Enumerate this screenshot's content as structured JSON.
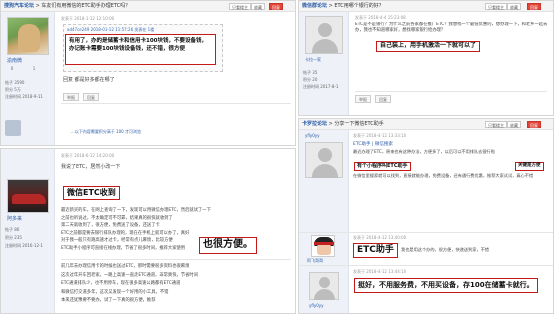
{
  "panel_a": {
    "site": "搜狗汽车论坛",
    "title": "车友们有用微信的ETC助手办理ETC吗？",
    "btn_a": "只看楼主",
    "btn_b": "收藏",
    "btn_c": "回复",
    "username": "渝南微",
    "user_stats": [
      "0",
      "1",
      "0"
    ],
    "user_info": [
      "帖子 3590",
      "积分 5万",
      "注册时间 2018-9-11"
    ],
    "meta": "发表于 2018-1-12 12:10:00",
    "quote_head": "ad47ce249 2018-01-12 11:57:26 发表在 1楼",
    "quote_text": "有用了，办的是储蓄卡和信用卡都可以办，不需要设备，办完了很快就能收到，还不错，我的车都是在上面办的",
    "highlight": "有用了，办的是储蓄卡和信用卡100块钱，不要设备钱，办记账卡需要100块钱设备钱，还不错，很方便",
    "reply": "回复 都是好多都在哪了",
    "btn_report": "举报",
    "btn_reply": "回复",
    "footer_link": "...以下内容需要积分高于 100 才可浏览"
  },
  "panel_b": {
    "site": "微信群论坛",
    "title": "ETC用哪个银行的好？",
    "btn_a": "只看楼主",
    "btn_b": "收藏",
    "btn_c": "回复",
    "username": "卡拉一家",
    "user_info": [
      "帖子 35",
      "积分 20",
      "注册时间 2017-8-1"
    ],
    "meta": "发表于 2018-4-4 15:23:08",
    "text": "ETC是不是银行？为什么之前各家都在推广ETC？我想找一个最低优惠的，想办理一下，和老乡一起去办，我也不知道哪家好，想找哪家银行给办理？",
    "highlight": "自己装上，用手机激活一下就可以了",
    "btn_report": "举报",
    "btn_reply": "回复"
  },
  "panel_c": {
    "username": "阿多来",
    "user_info": [
      "帖子 86",
      "积分 235",
      "注册时间 2016-12-1"
    ],
    "meta": "发表于 2018-6-12 14:20:00",
    "title": "我说了ETC，居然小改一下",
    "highlight1": "微信ETC收到",
    "lines": [
      "最近新买的车，在网上查询了一下，发现可以用微信办理ETC，然后就试了一下",
      "之前也听说过，不太确定可不可靠，结果真的很快就收到了",
      "第二天就收到了，很方便，免费送了设备，还送了卡",
      "ETC之前都是要去银行排队办理的，现在在手机上就可以办了，真好",
      "对于我一般只有跑高速才过卡，经常有点儿麻烦，比较方便",
      "ETC助手小程序可直接在线办理，节省了很多时间，推荐大家使用"
    ],
    "highlight2": "也很方便。",
    "lines2": [
      "前几年去办理信用卡的时候也送过ETC，那时需要很多资料也很麻烦",
      "这次过年开车回老家，一路上高速一直走ETC通道，非常爽快，节省时间",
      "ETC通道排队少，也不用停车，现在很多高速公路都有ETC通道",
      "和微信打交道多年，这次又发现一个好用的小工具，不错",
      "本来还犹豫要不要办，试了一下真的很方便，推荐"
    ]
  },
  "panel_d": {
    "site": "卡罗拉论坛",
    "title": "分享一下微信ETC助手",
    "btn_a": "只看楼主",
    "btn_b": "收藏",
    "btn_c": "回复",
    "user1": "yfly0yy",
    "meta1": "发表于 2018-4-12 13:33:10",
    "link": "ETC助手 | 微信搜索",
    "text1": "最近办理了ETC，原来也有这种办法，方便多了，以后可以不用排队去银行啦",
    "hl_a": "有个小程序叫ETC助手",
    "hl_b": "关键是方便",
    "text2": "在微信里搜索就可以找到，直接就能办理，免费设备，还有通行费优惠，推荐大家试试，真心不错",
    "user2": "阿飞哥哥",
    "meta2": "发表于 2018-4-12 13:40:00",
    "hl_c": "ETC助手",
    "text3": "我也是用这个办的，很方便，快递送到家，不错",
    "user3": "yfly0yy",
    "meta3": "发表于 2018-4-12 13:44:10",
    "hl_d": "挺好，不用服务费，不用买设备，存100在储蓄卡就行。"
  },
  "colors": {
    "highlight_border": "#c41a1a",
    "link": "#2a5ca8",
    "red_button": "#e3463b"
  }
}
